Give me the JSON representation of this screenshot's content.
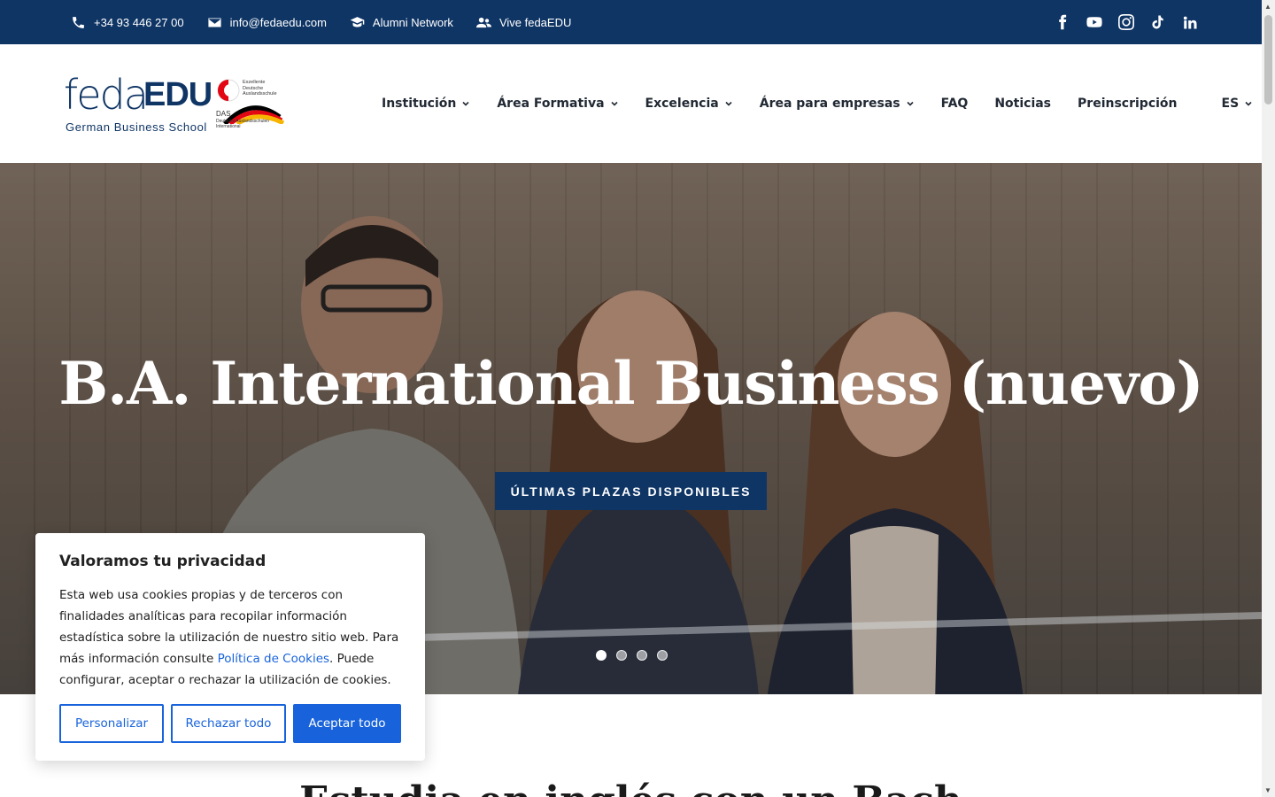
{
  "topbar": {
    "phone": "+34 93 446 27 00",
    "email": "info@fedaedu.com",
    "alumni": "Alumni Network",
    "vive": "Vive fedaEDU",
    "social": [
      "facebook-icon",
      "youtube-icon",
      "instagram-icon",
      "tiktok-icon",
      "linkedin-icon"
    ]
  },
  "logo": {
    "feda": "feda",
    "edu": "EDU",
    "subtitle": "German Business School",
    "badge_top": "Exzellente\nDeutsche\nAuslandsschule",
    "badge_das": "DAS",
    "badge_bottom": "Deutsche Auslandsschulen\nInternational"
  },
  "nav": {
    "items": [
      {
        "label": "Institución",
        "dropdown": true
      },
      {
        "label": "Área Formativa",
        "dropdown": true
      },
      {
        "label": "Excelencia",
        "dropdown": true
      },
      {
        "label": "Área para empresas",
        "dropdown": true
      },
      {
        "label": "FAQ",
        "dropdown": false
      },
      {
        "label": "Noticias",
        "dropdown": false
      },
      {
        "label": "Preinscripción",
        "dropdown": false
      }
    ],
    "language": "ES"
  },
  "hero": {
    "title": "B.A. International Business (nuevo)",
    "cta": "ÚLTIMAS PLAZAS DISPONIBLES",
    "slides_total": 4,
    "slide_active": 1
  },
  "section": {
    "heading": "Estudia en inglés con un Bach"
  },
  "cookie": {
    "title": "Valoramos tu privacidad",
    "text_before": "Esta web usa cookies propias y de terceros con finalidades analíticas para recopilar información estadística sobre la utilización de nuestro sitio web. Para más información consulte ",
    "link": "Política de Cookies",
    "text_after": ". Puede configurar, aceptar o rechazar la utilización de cookies.",
    "customize": "Personalizar",
    "reject": "Rechazar todo",
    "accept": "Aceptar todo"
  },
  "colors": {
    "brand_navy": "#0f3565",
    "cookie_blue": "#1863dc"
  }
}
